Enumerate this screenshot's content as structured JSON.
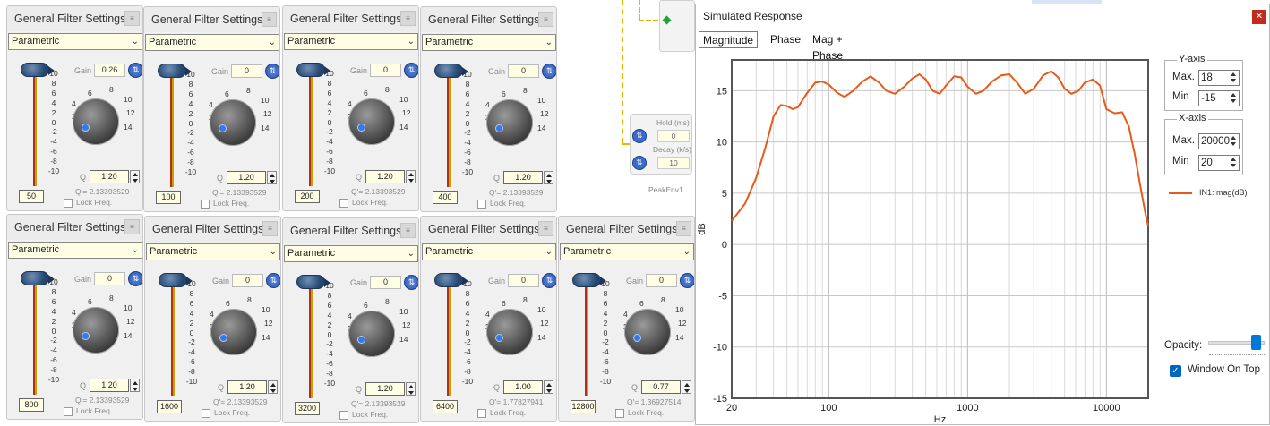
{
  "filter_panel": {
    "title": "General Filter Settings",
    "close": "≡",
    "type": "Parametric",
    "gain_label": "Gain",
    "q_label": "Q",
    "qprime_label": "Q'=",
    "lock_label": "Lock Freq.",
    "link_glyph": "⇅",
    "scale": [
      "10",
      "8",
      "6",
      "4",
      "2",
      "0",
      "-2",
      "-4",
      "-6",
      "-8",
      "-10"
    ],
    "knob_marks": [
      "0",
      "2",
      "4",
      "6",
      "8",
      "10",
      "12",
      "14"
    ]
  },
  "filters": [
    {
      "freq": "50",
      "gain": "0.26",
      "q": "1.20",
      "qprime": "2.13393529"
    },
    {
      "freq": "100",
      "gain": "0",
      "q": "1.20",
      "qprime": "2.13393529"
    },
    {
      "freq": "200",
      "gain": "0",
      "q": "1.20",
      "qprime": "2.13393529"
    },
    {
      "freq": "400",
      "gain": "0",
      "q": "1.20",
      "qprime": "2.13393529"
    },
    {
      "freq": "800",
      "gain": "0",
      "q": "1.20",
      "qprime": "2.13393529"
    },
    {
      "freq": "1600",
      "gain": "0",
      "q": "1.20",
      "qprime": "2.13393529"
    },
    {
      "freq": "3200",
      "gain": "0",
      "q": "1.20",
      "qprime": "2.13393529"
    },
    {
      "freq": "6400",
      "gain": "0",
      "q": "1.00",
      "qprime": "1.77827941"
    },
    {
      "freq": "12800",
      "gain": "0",
      "q": "0.77",
      "qprime": "1.36927514"
    }
  ],
  "peak_env": {
    "name": "PeakEnv1",
    "hold_label": "Hold (ms)",
    "hold": "0",
    "decay_label": "Decay (k/s)",
    "decay": "10"
  },
  "response": {
    "title": "Simulated Response",
    "close": "✕",
    "tabs": [
      "Magnitude",
      "Phase",
      "Mag + Phase"
    ],
    "yaxis": {
      "title": "Y-axis",
      "max_label": "Max.",
      "max": "18",
      "min_label": "Min",
      "min": "-15"
    },
    "xaxis": {
      "title": "X-axis",
      "max_label": "Max.",
      "max": "20000",
      "min_label": "Min",
      "min": "20"
    },
    "legend": "IN1: mag(dB)",
    "opacity_label": "Opacity:",
    "opacity": 0.85,
    "window_on_top": "Window On Top",
    "check": "✓"
  },
  "chart_data": {
    "type": "line",
    "xlabel": "Hz",
    "ylabel": "dB",
    "xscale": "log",
    "xlim": [
      20,
      20000
    ],
    "ylim": [
      -15,
      18
    ],
    "yticks": [
      "15",
      "10",
      "5",
      "0",
      "-5",
      "-10",
      "-15"
    ],
    "xticks": [
      "20",
      "100",
      "1000",
      "10000"
    ],
    "grid": true,
    "series": [
      {
        "name": "IN1: mag(dB)",
        "color": "#e8591a",
        "x": [
          20,
          25,
          30,
          35,
          40,
          45,
          50,
          55,
          60,
          70,
          80,
          90,
          100,
          115,
          130,
          150,
          175,
          200,
          230,
          260,
          300,
          350,
          400,
          450,
          500,
          560,
          630,
          700,
          800,
          900,
          1000,
          1150,
          1300,
          1500,
          1750,
          2000,
          2300,
          2600,
          3000,
          3500,
          4000,
          4500,
          5000,
          5600,
          6300,
          7000,
          8000,
          9000,
          10000,
          11500,
          13000,
          14500,
          16000,
          17500,
          19000,
          20000
        ],
        "y": [
          2.3,
          4.0,
          6.5,
          9.5,
          12.5,
          13.6,
          13.5,
          13.2,
          13.4,
          14.8,
          15.8,
          15.9,
          15.6,
          14.8,
          14.4,
          15.0,
          15.9,
          16.4,
          15.8,
          15.0,
          14.7,
          15.4,
          16.2,
          16.6,
          16.1,
          15.0,
          14.7,
          15.5,
          16.4,
          16.3,
          15.4,
          14.7,
          15.0,
          15.9,
          16.5,
          16.6,
          15.7,
          14.7,
          15.2,
          16.5,
          16.9,
          16.3,
          15.2,
          14.7,
          15.0,
          15.8,
          16.1,
          15.5,
          13.2,
          12.8,
          12.9,
          11.5,
          8.8,
          5.8,
          3.2,
          1.8
        ]
      }
    ]
  }
}
